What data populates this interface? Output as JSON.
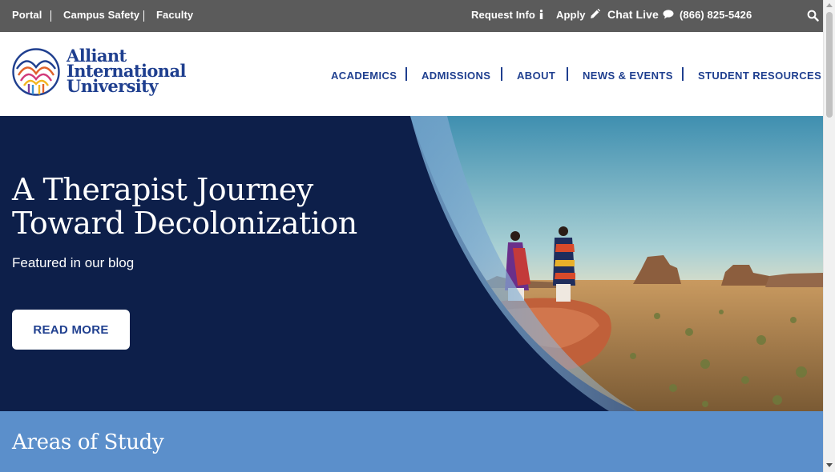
{
  "utility_bar": {
    "left_links": [
      "Portal",
      "Campus Safety",
      "Faculty"
    ],
    "request_info_label": "Request Info",
    "apply_label": "Apply",
    "chat_label": "Chat Live",
    "phone": "(866) 825-5426",
    "icons": {
      "request_info": "info-icon",
      "apply": "pencil-icon",
      "chat": "chat-bubble-icon",
      "search": "search-icon"
    }
  },
  "header": {
    "logo_lines": [
      "Alliant",
      "International",
      "University"
    ],
    "nav": [
      "ACADEMICS",
      "ADMISSIONS",
      "ABOUT",
      "NEWS & EVENTS",
      "STUDENT RESOURCES"
    ]
  },
  "hero": {
    "title": "A Therapist Journey Toward Decolonization",
    "subtitle": "Featured in our blog",
    "button_label": "READ MORE"
  },
  "areas": {
    "title": "Areas of Study"
  },
  "colors": {
    "utility_bg": "#5b5b5b",
    "brand_blue": "#1f3f8f",
    "hero_navy": "#0d1f4a",
    "areas_blue": "#5b8fcb"
  }
}
